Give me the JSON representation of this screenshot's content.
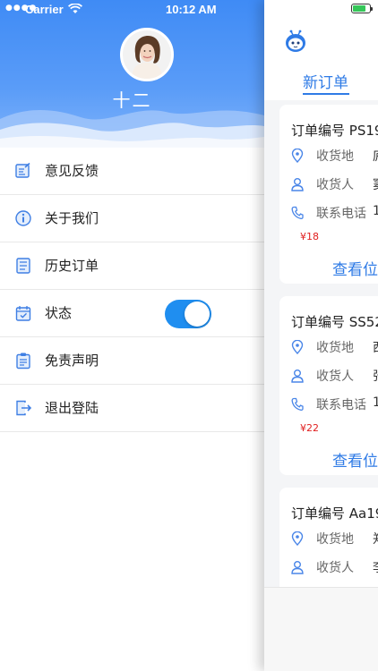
{
  "status_bar": {
    "carrier": "Carrier",
    "time": "10:12 AM"
  },
  "drawer": {
    "username": "十二",
    "menu": [
      {
        "label": "意见反馈",
        "icon": "feedback-icon"
      },
      {
        "label": "关于我们",
        "icon": "info-icon"
      },
      {
        "label": "历史订单",
        "icon": "history-list-icon"
      },
      {
        "label": "状态",
        "icon": "calendar-check-icon",
        "toggle_on": true
      },
      {
        "label": "免责声明",
        "icon": "clipboard-icon"
      },
      {
        "label": "退出登陆",
        "icon": "logout-icon"
      }
    ]
  },
  "main": {
    "tab_label": "新订单",
    "orders": [
      {
        "order_no": "订单编号 PS19",
        "addr_label": "收货地",
        "addr_val": "庐",
        "recv_label": "收货人",
        "recv_val": "窦",
        "phone_label": "联系电话",
        "phone_val": "1",
        "price": "¥18",
        "view": "查看位"
      },
      {
        "order_no": "订单编号 SS52",
        "addr_label": "收货地",
        "addr_val": "西",
        "recv_label": "收货人",
        "recv_val": "张",
        "phone_label": "联系电话",
        "phone_val": "1",
        "price": "¥22",
        "view": "查看位"
      },
      {
        "order_no": "订单编号 Aa19",
        "addr_label": "收货地",
        "addr_val": "郑",
        "recv_label": "收货人",
        "recv_val": "李"
      }
    ]
  },
  "colors": {
    "brand_blue": "#2f7be6",
    "toggle_on": "#1f8ef0",
    "price_red": "#e02020"
  }
}
